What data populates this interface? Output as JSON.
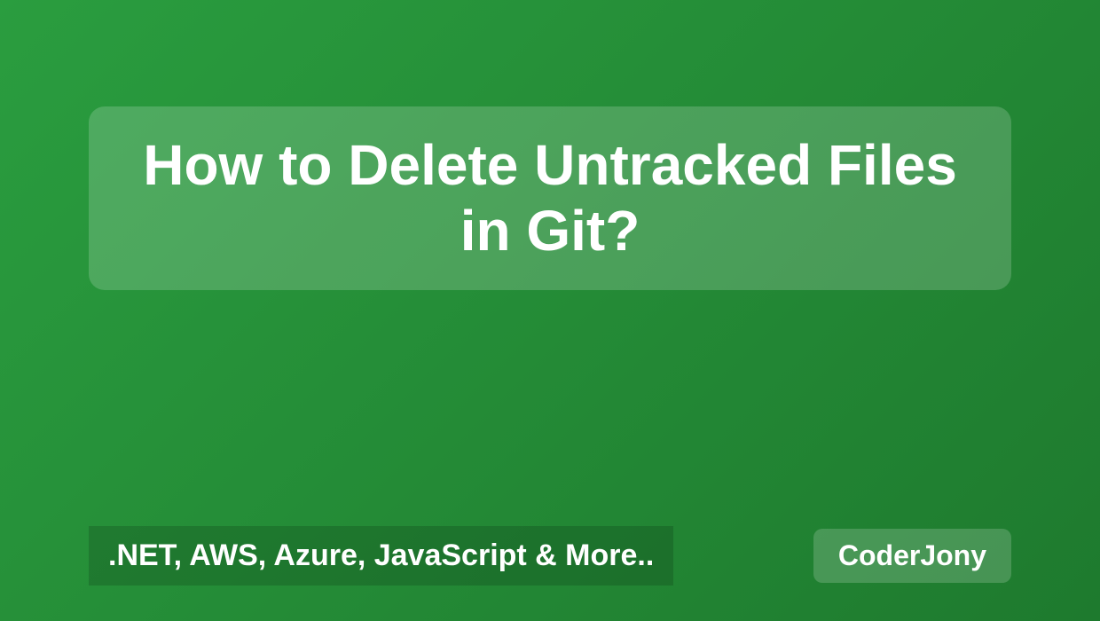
{
  "title": "How to Delete Untracked Files in Git?",
  "tagline": ".NET, AWS, Azure, JavaScript & More..",
  "brand": "CoderJony"
}
